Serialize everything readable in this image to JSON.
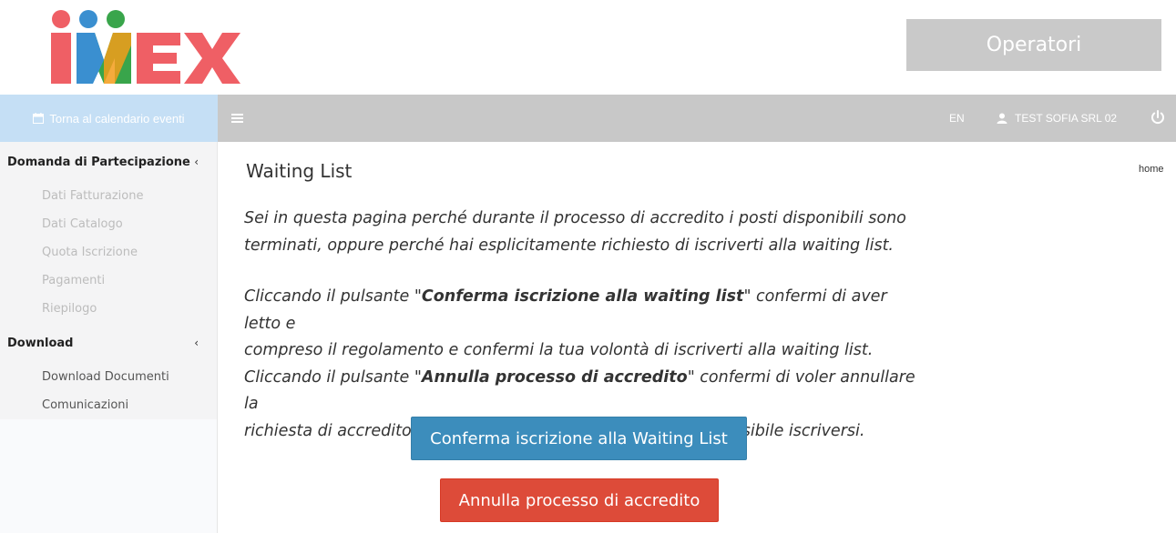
{
  "brand": {
    "logo_text": "IMEX"
  },
  "header": {
    "operatori_label": "Operatori"
  },
  "topbar": {
    "calendar_link": "Torna al calendario eventi",
    "lang": "EN",
    "user": "TEST SOFIA SRL 02"
  },
  "sidebar": {
    "section1": {
      "title": "Domanda di Partecipazione",
      "items": [
        "Dati Fatturazione",
        "Dati Catalogo",
        "Quota Iscrizione",
        "Pagamenti",
        "Riepilogo"
      ]
    },
    "section2": {
      "title": "Download",
      "items": [
        "Download Documenti",
        "Comunicazioni"
      ]
    }
  },
  "main": {
    "title": "Waiting List",
    "breadcrumb": "home",
    "p1_line1": "Sei in questa pagina perché durante il processo di accredito i posti disponibili sono",
    "p1_line2": "terminati, oppure perché hai esplicitamente richiesto di iscriverti alla waiting list.",
    "p2_l1_pre": "Cliccando il pulsante \"",
    "p2_l1_bold": "Conferma iscrizione alla waiting list",
    "p2_l1_post": "\" confermi di aver letto e",
    "p2_line2": "compreso il regolamento e confermi la tua volontà di iscriverti alla waiting list.",
    "p2_l3_pre": "Cliccando il pulsante \"",
    "p2_l3_bold": "Annulla processo di accredito",
    "p2_l3_post": "\" confermi di voler annullare la",
    "p2_line4": "richiesta di accredito. Come da regolamento, non sarà più possibile iscriversi.",
    "confirm_button": "Conferma iscrizione alla Waiting List",
    "cancel_button": "Annulla processo di accredito"
  },
  "colors": {
    "logo_red": "#ef5f65",
    "logo_blue": "#3a8fd0",
    "logo_green": "#39a54b",
    "logo_orange": "#f39c1a",
    "primary": "#3c8dbc",
    "danger": "#dd4b39"
  }
}
